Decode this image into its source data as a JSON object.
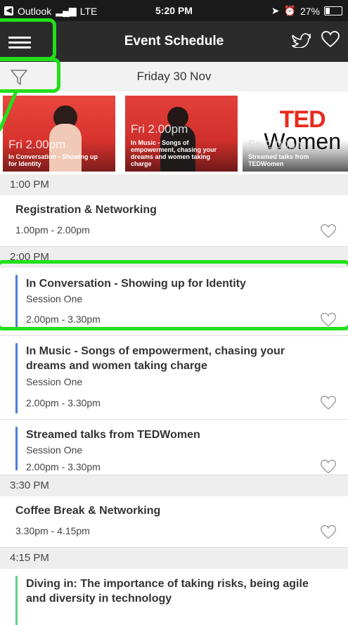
{
  "status_bar": {
    "back_app": "Outlook",
    "network": "LTE",
    "time": "5:20 PM",
    "battery": "27%",
    "battery_level": 0.27
  },
  "header": {
    "title": "Event Schedule"
  },
  "filter_bar": {
    "date": "Friday 30 Nov"
  },
  "carousel": [
    {
      "time": "Fri 2.00pm",
      "caption": "In Conversation - Showing up for Identity"
    },
    {
      "time": "Fri 2.00pm",
      "caption": "In Music - Songs of empowerment, chasing your dreams and women taking charge"
    },
    {
      "time": "Fri 2.00pm",
      "caption": "Streamed talks from TEDWomen",
      "logo_top": "TED",
      "logo_bottom": "Women"
    }
  ],
  "schedule": {
    "groups": [
      {
        "hour": "1:00 PM",
        "items": [
          {
            "title": "Registration & Networking",
            "time": "1.00pm - 2.00pm"
          }
        ]
      },
      {
        "hour": "2:00 PM",
        "items": [
          {
            "title": "In Conversation - Showing up for Identity",
            "session": "Session One",
            "time": "2.00pm - 3.30pm"
          },
          {
            "title": "In Music - Songs of empowerment, chasing your dreams and women taking charge",
            "session": "Session One",
            "time": "2.00pm - 3.30pm"
          },
          {
            "title": "Streamed talks from TEDWomen",
            "session": "Session One",
            "time": "2.00pm - 3.30pm"
          }
        ]
      },
      {
        "hour": "3:30 PM",
        "items": [
          {
            "title": "Coffee Break & Networking",
            "time": "3.30pm - 4.15pm"
          }
        ]
      },
      {
        "hour": "4:15 PM",
        "items": [
          {
            "title": "Diving in: The importance of taking risks, being agile and diversity in technology"
          }
        ]
      }
    ]
  },
  "colors": {
    "highlight": "#22e01a",
    "session_bar_blue": "#4a7fd4",
    "session_bar_green": "#5fd18a",
    "ted_red": "#e62b1e"
  },
  "icons": {
    "menu": "hamburger-menu-icon",
    "filter": "funnel-icon",
    "twitter": "twitter-bird-icon",
    "favorite": "heart-icon"
  }
}
